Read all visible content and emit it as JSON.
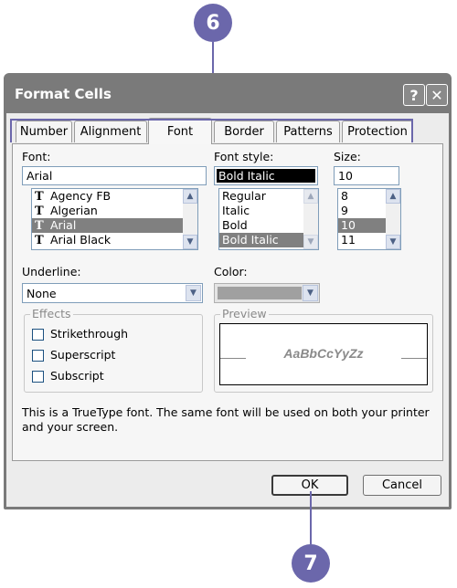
{
  "callouts": {
    "top": "6",
    "bottom": "7"
  },
  "dialog": {
    "title": "Format Cells",
    "help_label": "?",
    "close_label": "✕"
  },
  "tabs": [
    {
      "label": "Number",
      "active": false
    },
    {
      "label": "Alignment",
      "active": false
    },
    {
      "label": "Font",
      "active": true
    },
    {
      "label": "Border",
      "active": false
    },
    {
      "label": "Patterns",
      "active": false
    },
    {
      "label": "Protection",
      "active": false
    }
  ],
  "font": {
    "label": "Font:",
    "value": "Arial",
    "options": [
      {
        "name": "Agency FB",
        "selected": false
      },
      {
        "name": "Algerian",
        "selected": false
      },
      {
        "name": "Arial",
        "selected": true
      },
      {
        "name": "Arial Black",
        "selected": false
      }
    ],
    "truetype_glyph": "T"
  },
  "font_style": {
    "label": "Font style:",
    "value": "Bold Italic",
    "options": [
      {
        "name": "Regular",
        "selected": false
      },
      {
        "name": "Italic",
        "selected": false
      },
      {
        "name": "Bold",
        "selected": false
      },
      {
        "name": "Bold Italic",
        "selected": true
      }
    ]
  },
  "size": {
    "label": "Size:",
    "value": "10",
    "options": [
      {
        "name": "8",
        "selected": false
      },
      {
        "name": "9",
        "selected": false
      },
      {
        "name": "10",
        "selected": true
      },
      {
        "name": "11",
        "selected": false
      }
    ]
  },
  "underline": {
    "label": "Underline:",
    "value": "None"
  },
  "color": {
    "label": "Color:",
    "swatch": "#a0a0a0"
  },
  "effects": {
    "label": "Effects",
    "items": [
      {
        "label": "Strikethrough",
        "checked": false
      },
      {
        "label": "Superscript",
        "checked": false
      },
      {
        "label": "Subscript",
        "checked": false
      }
    ]
  },
  "preview": {
    "label": "Preview",
    "sample": "AaBbCcYyZz"
  },
  "note": {
    "line1": "This is a TrueType font.  The same font will be used on both your printer",
    "line2": "and your screen."
  },
  "buttons": {
    "ok": "OK",
    "cancel": "Cancel"
  },
  "icons": {
    "scroll_up": "▲",
    "scroll_down": "▼"
  },
  "colors": {
    "accent": "#6b67ab",
    "selection": "#808080",
    "titlebar": "#7a7a7a"
  }
}
